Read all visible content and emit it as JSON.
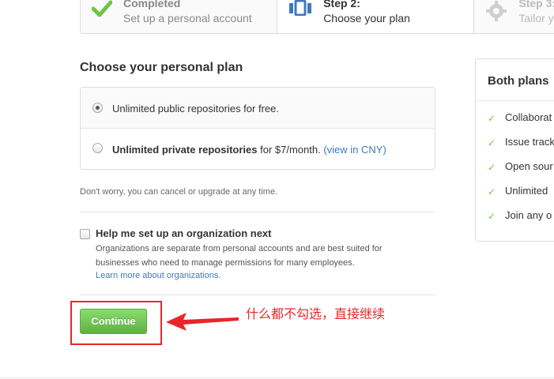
{
  "steps": [
    {
      "title": "Completed",
      "subtitle": "Set up a personal account"
    },
    {
      "title": "Step 2:",
      "subtitle": "Choose your plan"
    },
    {
      "title": "Step 3:",
      "subtitle": "Tailor yo"
    }
  ],
  "plan": {
    "heading": "Choose your personal plan",
    "option_free": "Unlimited public repositories for free.",
    "option_paid_bold": "Unlimited private repositories",
    "option_paid_rest": " for $7/month. ",
    "option_paid_link": "(view in CNY)",
    "selected": "free"
  },
  "note": "Don't worry, you can cancel or upgrade at any time.",
  "organization": {
    "title": "Help me set up an organization next",
    "description": "Organizations are separate from personal accounts and are best suited for businesses who need to manage permissions for many employees.",
    "link": "Learn more about organizations.",
    "checked": false
  },
  "continue_label": "Continue",
  "annotation": {
    "text": "什么都不勾选，直接继续",
    "color": "#e8262a"
  },
  "side_panel": {
    "heading": "Both plans",
    "items": [
      "Collaborat",
      "Issue track",
      "Open sour",
      "Unlimited",
      "Join any o"
    ]
  },
  "colors": {
    "accent_green": "#6cc644",
    "link_blue": "#4078c0",
    "button_green": "#60b044"
  }
}
